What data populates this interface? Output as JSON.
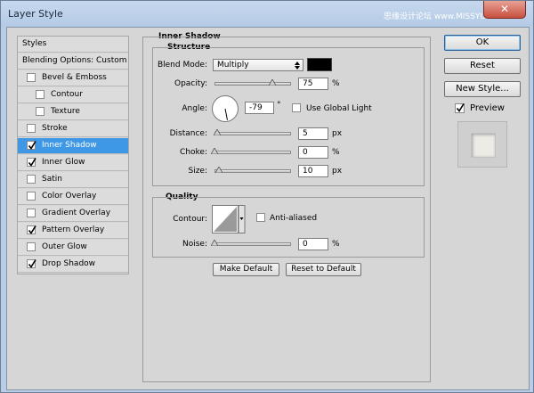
{
  "window": {
    "title": "Layer Style",
    "watermark": "思缘设计论坛 www.MISSYUAN.COM",
    "close_glyph": "✕"
  },
  "style_list": {
    "items": [
      {
        "label": "Styles",
        "checkbox": false,
        "checked": false,
        "indent": 0,
        "selected": false
      },
      {
        "label": "Blending Options: Custom",
        "checkbox": false,
        "checked": false,
        "indent": 0,
        "selected": false
      },
      {
        "label": "Bevel & Emboss",
        "checkbox": true,
        "checked": false,
        "indent": 0,
        "selected": false
      },
      {
        "label": "Contour",
        "checkbox": true,
        "checked": false,
        "indent": 1,
        "selected": false
      },
      {
        "label": "Texture",
        "checkbox": true,
        "checked": false,
        "indent": 1,
        "selected": false
      },
      {
        "label": "Stroke",
        "checkbox": true,
        "checked": false,
        "indent": 0,
        "selected": false
      },
      {
        "label": "Inner Shadow",
        "checkbox": true,
        "checked": true,
        "indent": 0,
        "selected": true
      },
      {
        "label": "Inner Glow",
        "checkbox": true,
        "checked": true,
        "indent": 0,
        "selected": false
      },
      {
        "label": "Satin",
        "checkbox": true,
        "checked": false,
        "indent": 0,
        "selected": false
      },
      {
        "label": "Color Overlay",
        "checkbox": true,
        "checked": false,
        "indent": 0,
        "selected": false
      },
      {
        "label": "Gradient Overlay",
        "checkbox": true,
        "checked": false,
        "indent": 0,
        "selected": false
      },
      {
        "label": "Pattern Overlay",
        "checkbox": true,
        "checked": true,
        "indent": 0,
        "selected": false
      },
      {
        "label": "Outer Glow",
        "checkbox": true,
        "checked": false,
        "indent": 0,
        "selected": false
      },
      {
        "label": "Drop Shadow",
        "checkbox": true,
        "checked": true,
        "indent": 0,
        "selected": false
      }
    ]
  },
  "panel": {
    "heading": "Inner Shadow",
    "structure": {
      "title": "Structure",
      "blend_mode": {
        "label": "Blend Mode:",
        "value": "Multiply",
        "color": "#000000"
      },
      "opacity": {
        "label": "Opacity:",
        "value": "75",
        "unit": "%",
        "percent": 75
      },
      "angle": {
        "label": "Angle:",
        "value": "-79",
        "unit": "°",
        "degrees": -79
      },
      "global_light": {
        "label": "Use Global Light",
        "checked": false
      },
      "distance": {
        "label": "Distance:",
        "value": "5",
        "unit": "px",
        "fraction": 0.03
      },
      "choke": {
        "label": "Choke:",
        "value": "0",
        "unit": "%",
        "fraction": 0
      },
      "size": {
        "label": "Size:",
        "value": "10",
        "unit": "px",
        "fraction": 0.06
      }
    },
    "quality": {
      "title": "Quality",
      "contour": {
        "label": "Contour:"
      },
      "anti_aliased": {
        "label": "Anti-aliased",
        "checked": false
      },
      "noise": {
        "label": "Noise:",
        "value": "0",
        "unit": "%",
        "fraction": 0
      }
    },
    "buttons": {
      "make_default": "Make Default",
      "reset_default": "Reset to Default"
    }
  },
  "side_buttons": {
    "ok": "OK",
    "reset": "Reset",
    "new_style": "New Style...",
    "preview": "Preview",
    "preview_checked": true
  },
  "colors": {
    "selection": "#3f98e6",
    "dialog": "#d6d6d6",
    "frame": "#b9cde6"
  }
}
